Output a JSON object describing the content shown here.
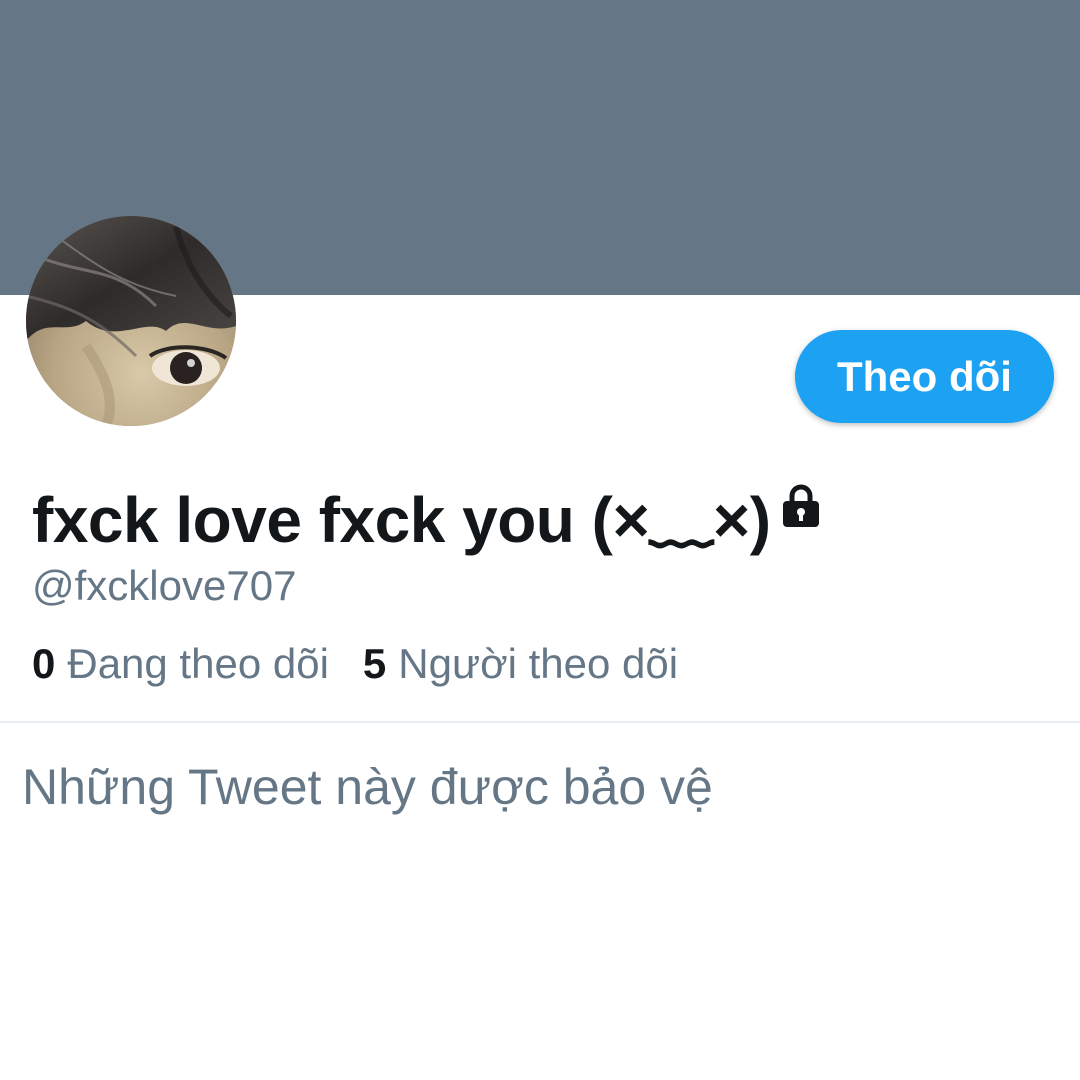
{
  "profile": {
    "display_name": "fxck love fxck you (×﹏×)",
    "handle": "@fxcklove707",
    "protected": true
  },
  "actions": {
    "follow_label": "Theo dõi"
  },
  "stats": {
    "following_count": "0",
    "following_label": "Đang theo dõi",
    "followers_count": "5",
    "followers_label": "Người theo dõi"
  },
  "timeline": {
    "protected_message": "Những Tweet này được bảo vệ"
  },
  "icons": {
    "lock": "lock-icon"
  },
  "colors": {
    "banner": "#657786",
    "accent": "#1da1f2",
    "text_primary": "#14171a",
    "text_secondary": "#657786",
    "divider": "#e6ecf0"
  }
}
